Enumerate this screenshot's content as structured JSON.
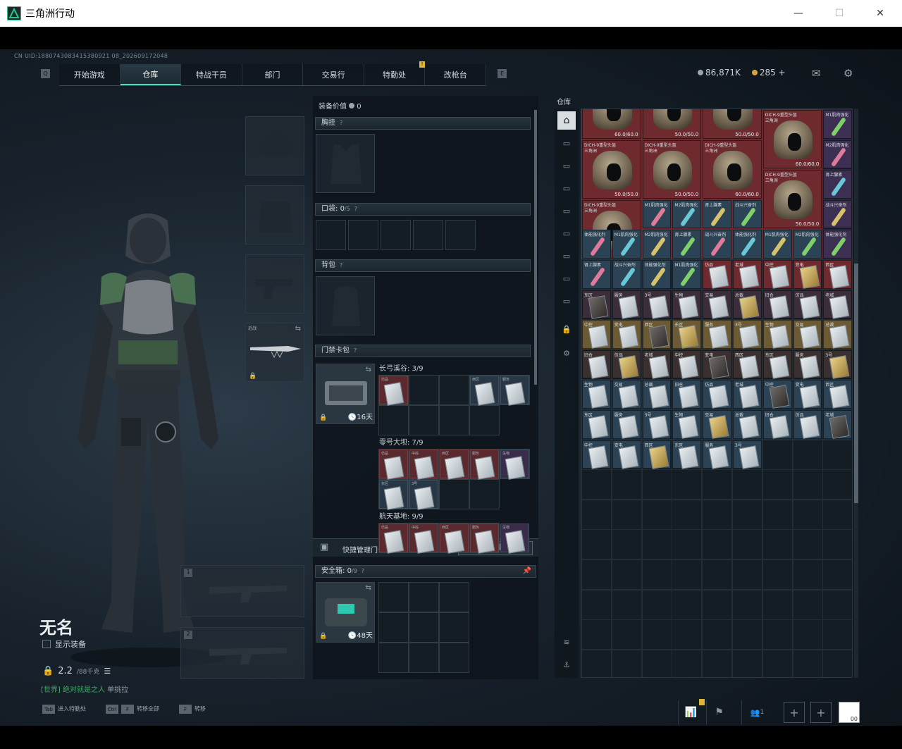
{
  "window": {
    "title": "三角洲行动",
    "minimize": "—",
    "maximize": "☐",
    "close": "✕"
  },
  "uid": "CN UID:1880743083415380921 08_202609172048",
  "nav": {
    "left_key": "Q",
    "right_key": "E",
    "tabs": [
      "开始游戏",
      "仓库",
      "特战干员",
      "部门",
      "交易行",
      "特勤处",
      "改枪台"
    ],
    "active": "仓库",
    "badge": "!"
  },
  "currency": {
    "havcoins": "86,871K",
    "coupons": "285 +"
  },
  "character": {
    "name": "无名",
    "show_equipment": "显示装备",
    "weight": "2.2",
    "weight_unit": "/88千克",
    "title_colored": "[世界] 绝对就是之人",
    "title_suffix": "单挑拉"
  },
  "slots": {
    "weapon1_num": "1",
    "weapon2_num": "2",
    "melee_label": "近战"
  },
  "equipment": {
    "value_label": "装备价值",
    "value": "0",
    "chest_rig": "胸挂",
    "pockets": "口袋:",
    "pockets_count": "0",
    "pockets_cap": "/5",
    "backpack": "背包",
    "keycard_case": "门禁卡包",
    "case_days": "16天",
    "maps": [
      {
        "label": "长弓溪谷: 3/9"
      },
      {
        "label": "零号大坝: 7/9"
      },
      {
        "label": "航天基地: 9/9"
      }
    ],
    "quick_manage": "快捷管理门卡",
    "manage_button": "管理",
    "safebox": "安全箱:",
    "safebox_count": "0",
    "safebox_cap": "/9",
    "safebox_days": "48天",
    "help": "?"
  },
  "warehouse": {
    "label": "仓库",
    "helmet_name_a": "DICH-9重型头盔",
    "helmet_name_b": "三角洲",
    "durability_60": "60.0/60.0",
    "durability_50": "50.0/50.0",
    "stim_names": [
      "M1肌肉强化",
      "M2肌肉强化",
      "肾上腺素",
      "战斗兴奋剂",
      "体能强化剂"
    ],
    "card_names": [
      "仿品",
      "老城",
      "中控",
      "变电",
      "西区",
      "东区",
      "服务",
      "3号",
      "生物",
      "交易",
      "总裁",
      "旧仓"
    ]
  },
  "footer": {
    "tab_key": "Tab",
    "tab_label": "进入特勤处",
    "ctrl_key": "Ctrl",
    "f_key": "F",
    "ctrl_label": "转移全部",
    "f_label": "转移",
    "squad_count": "1",
    "avatar_label": "00"
  },
  "colors": {
    "accent": "#4de0b2",
    "red_rarity": "#6e2a2f",
    "gold_rarity": "#6b5a33",
    "blue_rarity": "#2b4354",
    "purple_rarity": "#3d2f52"
  }
}
